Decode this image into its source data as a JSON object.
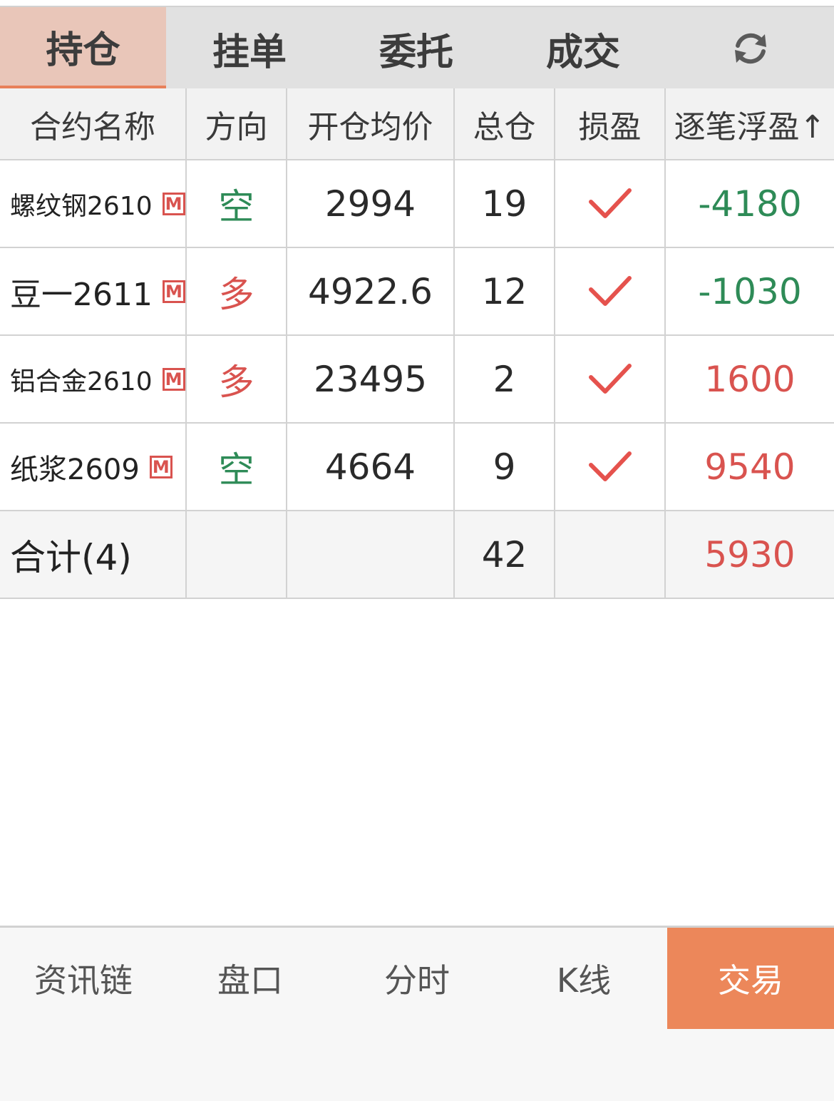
{
  "tabs": [
    {
      "label": "持仓",
      "active": true
    },
    {
      "label": "挂单",
      "active": false
    },
    {
      "label": "委托",
      "active": false
    },
    {
      "label": "成交",
      "active": false
    }
  ],
  "refresh_icon": "refresh-icon",
  "table": {
    "headers": [
      "合约名称",
      "方向",
      "开仓均价",
      "总仓",
      "损盈",
      "逐笔浮盈↑"
    ],
    "rows": [
      {
        "name": "螺纹钢2610",
        "badge": "M",
        "direction": "空",
        "price": "2994",
        "qty": "19",
        "stop": "check",
        "pnl": "-4180"
      },
      {
        "name": "豆一2611",
        "badge": "M",
        "direction": "多",
        "price": "4922.6",
        "qty": "12",
        "stop": "check",
        "pnl": "-1030"
      },
      {
        "name": "铝合金2610",
        "badge": "M",
        "direction": "多",
        "price": "23495",
        "qty": "2",
        "stop": "check",
        "pnl": "1600"
      },
      {
        "name": "纸浆2609",
        "badge": "M",
        "direction": "空",
        "price": "4664",
        "qty": "9",
        "stop": "check",
        "pnl": "9540"
      }
    ],
    "total": {
      "label": "合计(4)",
      "qty": "42",
      "pnl": "5930"
    }
  },
  "colors": {
    "accent": "#ec875a",
    "up": "#d9534f",
    "down": "#2e8b57"
  },
  "bottom_nav": [
    {
      "label": "资讯链",
      "active": false
    },
    {
      "label": "盘口",
      "active": false
    },
    {
      "label": "分时",
      "active": false
    },
    {
      "label": "K线",
      "active": false
    },
    {
      "label": "交易",
      "active": true
    }
  ]
}
